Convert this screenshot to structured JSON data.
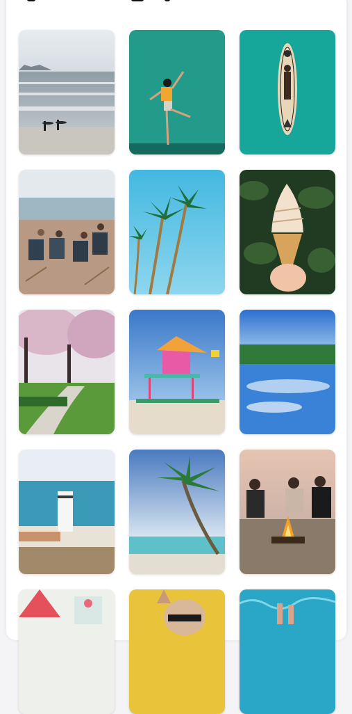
{
  "gallery": {
    "photos": [
      {
        "alt": "surfers-beach"
      },
      {
        "alt": "woman-teal-wall"
      },
      {
        "alt": "paddleboard-aerial"
      },
      {
        "alt": "friends-beach-chairs"
      },
      {
        "alt": "palm-trees-sky"
      },
      {
        "alt": "ice-cream-cone"
      },
      {
        "alt": "cherry-blossom-park"
      },
      {
        "alt": "lifeguard-tower"
      },
      {
        "alt": "lake-reflection"
      },
      {
        "alt": "water-carton-beach"
      },
      {
        "alt": "palm-beach"
      },
      {
        "alt": "campfire-friends"
      },
      {
        "alt": "watermelon-drinks"
      },
      {
        "alt": "sunglasses-yellow"
      },
      {
        "alt": "pool-feet"
      }
    ]
  }
}
